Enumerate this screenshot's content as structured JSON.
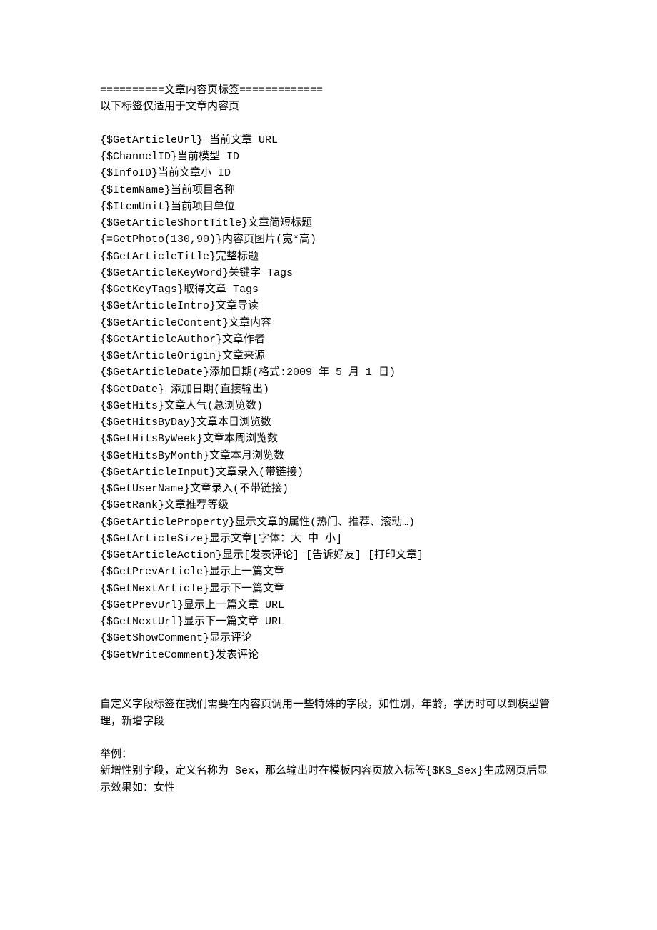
{
  "header1": "==========文章内容页标签=============",
  "header2": "以下标签仅适用于文章内容页",
  "tags": [
    "{$GetArticleUrl} 当前文章 URL",
    "{$ChannelID}当前模型 ID",
    "{$InfoID}当前文章小 ID",
    "{$ItemName}当前项目名称",
    "{$ItemUnit}当前项目单位",
    "{$GetArticleShortTitle}文章简短标题",
    "{=GetPhoto(130,90)}内容页图片(宽*高)",
    "{$GetArticleTitle}完整标题",
    "{$GetArticleKeyWord}关键字 Tags",
    "{$GetKeyTags}取得文章 Tags",
    "{$GetArticleIntro}文章导读",
    "{$GetArticleContent}文章内容",
    "{$GetArticleAuthor}文章作者",
    "{$GetArticleOrigin}文章来源",
    "{$GetArticleDate}添加日期(格式:2009 年 5 月 1 日)",
    "{$GetDate} 添加日期(直接输出)",
    "{$GetHits}文章人气(总浏览数)",
    "{$GetHitsByDay}文章本日浏览数",
    "{$GetHitsByWeek}文章本周浏览数",
    "{$GetHitsByMonth}文章本月浏览数",
    "{$GetArticleInput}文章录入(带链接)",
    "{$GetUserName}文章录入(不带链接)",
    "{$GetRank}文章推荐等级",
    "{$GetArticleProperty}显示文章的属性(热门、推荐、滚动…)",
    "{$GetArticleSize}显示文章[字体：大 中 小]",
    "{$GetArticleAction}显示[发表评论] [告诉好友] [打印文章]",
    "{$GetPrevArticle}显示上一篇文章",
    "{$GetNextArticle}显示下一篇文章",
    "{$GetPrevUrl}显示上一篇文章 URL",
    "{$GetNextUrl}显示下一篇文章 URL",
    "{$GetShowComment}显示评论",
    "{$GetWriteComment}发表评论"
  ],
  "custom_field_note": "自定义字段标签在我们需要在内容页调用一些特殊的字段，如性别，年龄，学历时可以到模型管理，新增字段",
  "example_label": "举例：",
  "example_text": "新增性别字段，定义名称为 Sex，那么输出时在模板内容页放入标签{$KS_Sex}生成网页后显示效果如：女性"
}
